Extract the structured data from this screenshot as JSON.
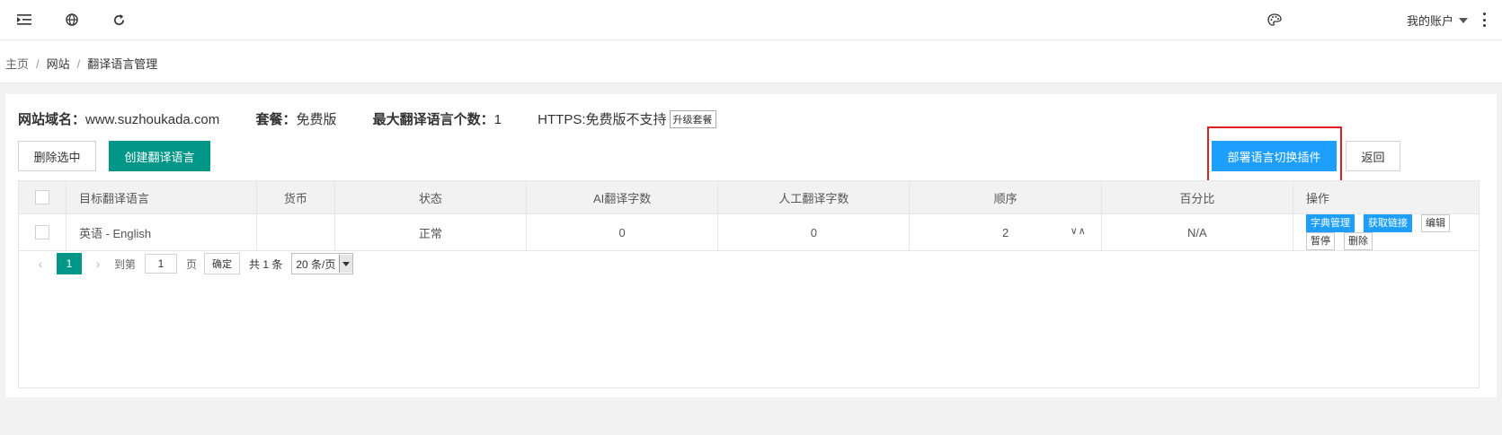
{
  "topbar": {
    "icons": [
      "menu-collapse-icon",
      "globe-icon",
      "refresh-icon",
      "palette-icon"
    ],
    "account_label": "我的账户"
  },
  "breadcrumb": [
    "主页",
    "网站",
    "翻译语言管理"
  ],
  "site_info": {
    "domain_label": "网站域名：",
    "domain_value": "www.suzhoukada.com",
    "plan_label": "套餐：",
    "plan_value": "免费版",
    "max_lang_label": "最大翻译语言个数：",
    "max_lang_value": "1",
    "https_text": "HTTPS:免费版不支持",
    "upgrade_label": "升级套餐"
  },
  "toolbar": {
    "delete_selected": "删除选中",
    "create_language": "创建翻译语言",
    "deploy_plugin": "部署语言切换插件",
    "back": "返回"
  },
  "table": {
    "headers": [
      "目标翻译语言",
      "货币",
      "状态",
      "AI翻译字数",
      "人工翻译字数",
      "顺序",
      "百分比",
      "操作"
    ],
    "rows": [
      {
        "language": "英语 - English",
        "currency": "",
        "status": "正常",
        "ai_words": "0",
        "human_words": "0",
        "order": "2",
        "percent": "N/A",
        "actions": [
          "字典管理",
          "获取链接",
          "编辑",
          "暂停",
          "删除"
        ]
      }
    ]
  },
  "pagination": {
    "current_page": "1",
    "goto_label": "到第",
    "page_input": "1",
    "page_suffix": "页",
    "confirm": "确定",
    "total": "共 1 条",
    "page_size": "20 条/页"
  },
  "colors": {
    "green": "#009688",
    "blue": "#1e9fff",
    "highlight_red": "#e02020"
  }
}
